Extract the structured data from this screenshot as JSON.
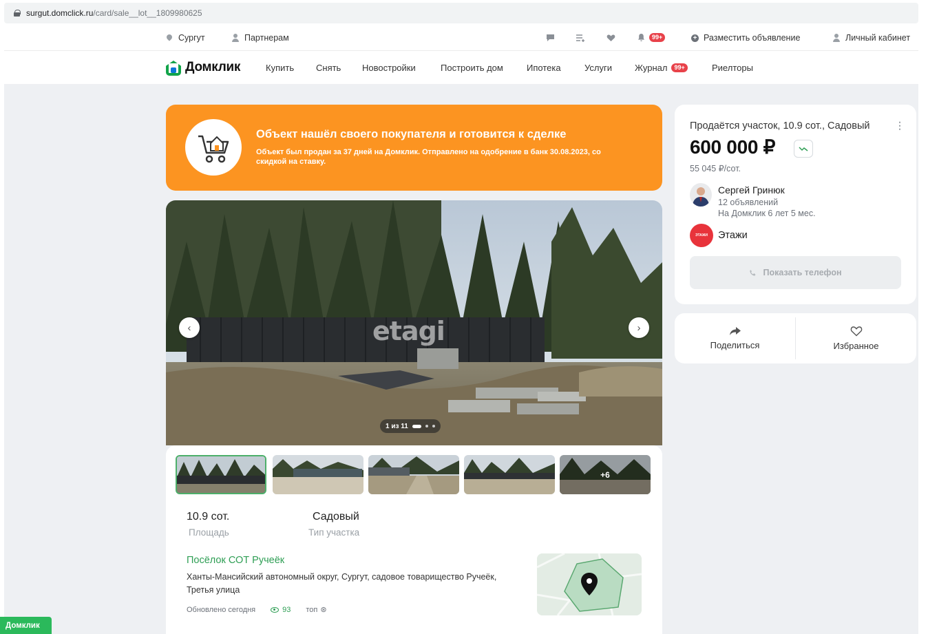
{
  "browser": {
    "url_host": "surgut.domclick.ru",
    "url_path": "/card/sale__lot__1809980625"
  },
  "topbar": {
    "city": "Сургут",
    "partners": "Партнерам",
    "notifications_badge": "99+",
    "post_ad": "Разместить объявление",
    "account": "Личный кабинет"
  },
  "nav": {
    "logo": "Домклик",
    "links": [
      "Купить",
      "Снять",
      "Новостройки",
      "Построить дом",
      "Ипотека",
      "Услуги",
      "Журнал",
      "Риелторы"
    ],
    "journal_badge": "99+"
  },
  "banner": {
    "title": "Объект нашёл своего покупателя и готовится к сделке",
    "subtitle": "Объект был продан за 37 дней на Домклик. Отправлено на одобрение в банк 30.08.2023, со скидкой на ставку."
  },
  "gallery": {
    "watermark": "etagi",
    "counter": "1 из 11",
    "more_photos": "+6",
    "progress_current": 1,
    "progress_total": 11
  },
  "facts": {
    "area_value": "10.9 сот.",
    "area_label": "Площадь",
    "type_value": "Садовый",
    "type_label": "Тип участка"
  },
  "location": {
    "village": "Посёлок СОТ Ручеёк",
    "address": "Ханты-Мансийский автономный округ, Сургут, садовое товарищество Ручеёк, Третья улица"
  },
  "meta": {
    "updated": "Обновлено сегодня",
    "views": "93",
    "top": "топ"
  },
  "offer": {
    "title": "Продаётся участок, 10.9 сот., Садовый",
    "price": "600 000 ₽",
    "price_per_unit": "55 045 ₽/сот.",
    "agent_name": "Сергей Гринюк",
    "agent_listings": "12 объявлений",
    "agent_tenure": "На Домклик 6 лет 5 мес.",
    "org_name": "Этажи",
    "org_logo_text": "ЭТАЖИ",
    "phone_button": "Показать телефон"
  },
  "actions": {
    "share": "Поделиться",
    "favorite": "Избранное"
  },
  "corner_tag": "Домклик",
  "colors": {
    "brand_green": "#12a44a",
    "banner_orange": "#fc9421",
    "badge_red": "#e8424a",
    "link_green": "#2e9e54"
  }
}
